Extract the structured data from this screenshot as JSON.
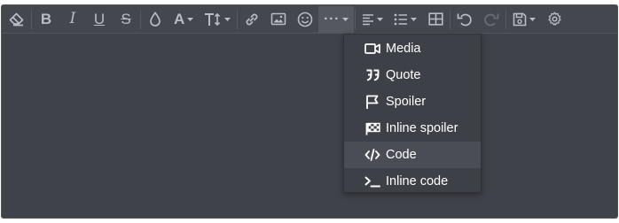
{
  "toolbar": {
    "buttons": [
      {
        "id": "clear-formatting",
        "icon": "eraser-icon"
      },
      {
        "id": "bold",
        "glyph": "B"
      },
      {
        "id": "italic",
        "glyph": "I"
      },
      {
        "id": "underline",
        "glyph": "U"
      },
      {
        "id": "strikethrough",
        "glyph": "S"
      },
      {
        "id": "text-color",
        "icon": "droplet-icon"
      },
      {
        "id": "font-family",
        "glyph": "A"
      },
      {
        "id": "font-size",
        "icon": "text-height-icon"
      },
      {
        "id": "insert-link",
        "icon": "link-icon"
      },
      {
        "id": "insert-image",
        "icon": "image-icon"
      },
      {
        "id": "insert-smilie",
        "icon": "smiley-icon"
      },
      {
        "id": "insert-more",
        "glyph": "···"
      },
      {
        "id": "align",
        "icon": "align-left-icon"
      },
      {
        "id": "list",
        "icon": "list-icon"
      },
      {
        "id": "table",
        "icon": "table-icon"
      },
      {
        "id": "undo",
        "icon": "undo-icon"
      },
      {
        "id": "redo",
        "icon": "redo-icon",
        "disabled": true
      },
      {
        "id": "drafts",
        "icon": "save-icon"
      },
      {
        "id": "settings",
        "icon": "gear-icon"
      }
    ]
  },
  "menu": {
    "items": [
      {
        "label": "Media",
        "icon": "video-camera-icon"
      },
      {
        "label": "Quote",
        "icon": "quote-icon"
      },
      {
        "label": "Spoiler",
        "icon": "flag-icon"
      },
      {
        "label": "Inline spoiler",
        "icon": "checkered-flag-icon"
      },
      {
        "label": "Code",
        "icon": "code-icon",
        "highlighted": true
      },
      {
        "label": "Inline code",
        "icon": "terminal-icon"
      }
    ]
  },
  "colors": {
    "editor_bg": "#3f4249",
    "toolbar_bg": "#44474e",
    "icon": "#b8bcc4",
    "menu_bg": "#3d4047",
    "menu_highlight": "#4a4d55",
    "menu_text": "#ffffff"
  }
}
